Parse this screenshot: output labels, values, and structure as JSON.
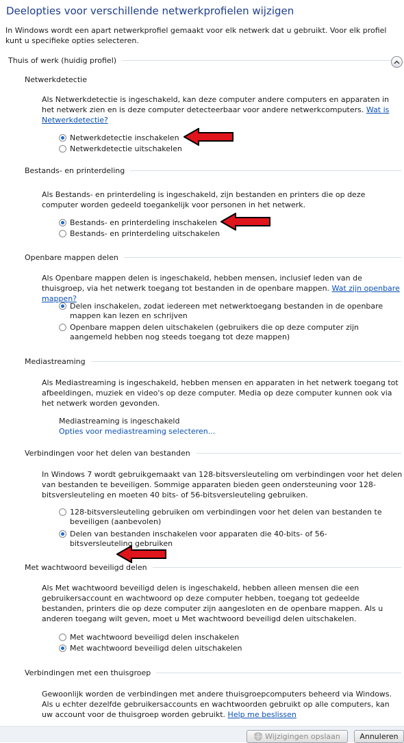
{
  "page_title": "Deelopties voor verschillende netwerkprofielen wijzigen",
  "intro": "In Windows wordt een apart netwerkprofiel gemaakt voor elk netwerk dat u gebruikt. Voor elk profiel kunt u specifieke opties selecteren.",
  "profile": {
    "label": "Thuis of werk (huidig profiel)",
    "expanded": true
  },
  "sections": {
    "netwerkdetectie": {
      "heading": "Netwerkdetectie",
      "text": "Als Netwerkdetectie is ingeschakeld, kan deze computer andere computers en apparaten in het netwerk zien en is deze computer detecteerbaar voor andere netwerkcomputers.",
      "link": "Wat is Netwerkdetectie?",
      "options": [
        "Netwerkdetectie inschakelen",
        "Netwerkdetectie uitschakelen"
      ],
      "selected": 0
    },
    "printerdeling": {
      "heading": "Bestands- en printerdeling",
      "text": "Als Bestands- en printerdeling is ingeschakeld, zijn bestanden en printers die op deze computer worden gedeeld toegankelijk voor personen in het netwerk.",
      "options": [
        "Bestands- en printerdeling inschakelen",
        "Bestands- en printerdeling uitschakelen"
      ],
      "selected": 0
    },
    "openbare_mappen": {
      "heading": "Openbare mappen delen",
      "text": "Als Openbare mappen delen is ingeschakeld, hebben mensen, inclusief leden van de thuisgroep, via het netwerk toegang tot bestanden in de openbare mappen.",
      "link": "Wat zijn openbare mappen?",
      "options": [
        "Delen inschakelen, zodat iedereen met netwerktoegang bestanden in de openbare mappen kan lezen en schrijven",
        "Openbare mappen delen uitschakelen (gebruikers die op deze computer zijn aangemeld hebben nog steeds toegang tot deze mappen)"
      ],
      "selected": 0
    },
    "mediastreaming": {
      "heading": "Mediastreaming",
      "text": "Als Mediastreaming is ingeschakeld, hebben mensen en apparaten in het netwerk toegang tot afbeeldingen, muziek en video's op deze computer. Media op deze computer kunnen ook via het netwerk worden gevonden.",
      "status": "Mediastreaming is ingeschakeld",
      "link": "Opties voor mediastreaming selecteren..."
    },
    "verbindingen": {
      "heading": "Verbindingen voor het delen van bestanden",
      "text": "In Windows 7 wordt gebruikgemaakt van 128-bitsversleuteling om verbindingen voor het delen van bestanden te beveiligen. Sommige apparaten bieden geen ondersteuning voor 128-bitsversleuteling en moeten 40 bits- of 56-bitsversleuteling gebruiken.",
      "options": [
        "128-bitsversleuteling gebruiken om verbindingen voor het delen van bestanden te beveiligen (aanbevolen)",
        "Delen van bestanden inschakelen voor apparaten die 40-bits- of 56-bitsversleuteling gebruiken"
      ],
      "selected": 1
    },
    "wachtwoord": {
      "heading": "Met wachtwoord beveiligd delen",
      "text": "Als Met wachtwoord beveiligd delen is ingeschakeld, hebben alleen mensen die een gebruikersaccount en wachtwoord op deze computer hebben, toegang tot gedeelde bestanden, printers die op deze computer zijn aangesloten en de openbare mappen. Als u anderen toegang wilt geven, moet u Met wachtwoord beveiligd delen uitschakelen.",
      "options": [
        "Met wachtwoord beveiligd delen inschakelen",
        "Met wachtwoord beveiligd delen uitschakelen"
      ],
      "selected": 1
    },
    "thuisgroep": {
      "heading": "Verbindingen met een thuisgroep",
      "text": "Gewoonlijk worden de verbindingen met andere thuisgroepcomputers beheerd via Windows. Als u echter dezelfde gebruikersaccounts en wachtwoorden gebruikt op alle computers, kan uw account voor de thuisgroep worden gebruikt.",
      "link": "Help me beslissen"
    }
  },
  "footer": {
    "save_label": "Wijzigingen opslaan",
    "cancel_label": "Annuleren"
  },
  "colors": {
    "title": "#1e3f8a",
    "link": "#0a4fb4",
    "arrow": "#e0141b",
    "radio_selected": "#1a6ad0"
  }
}
